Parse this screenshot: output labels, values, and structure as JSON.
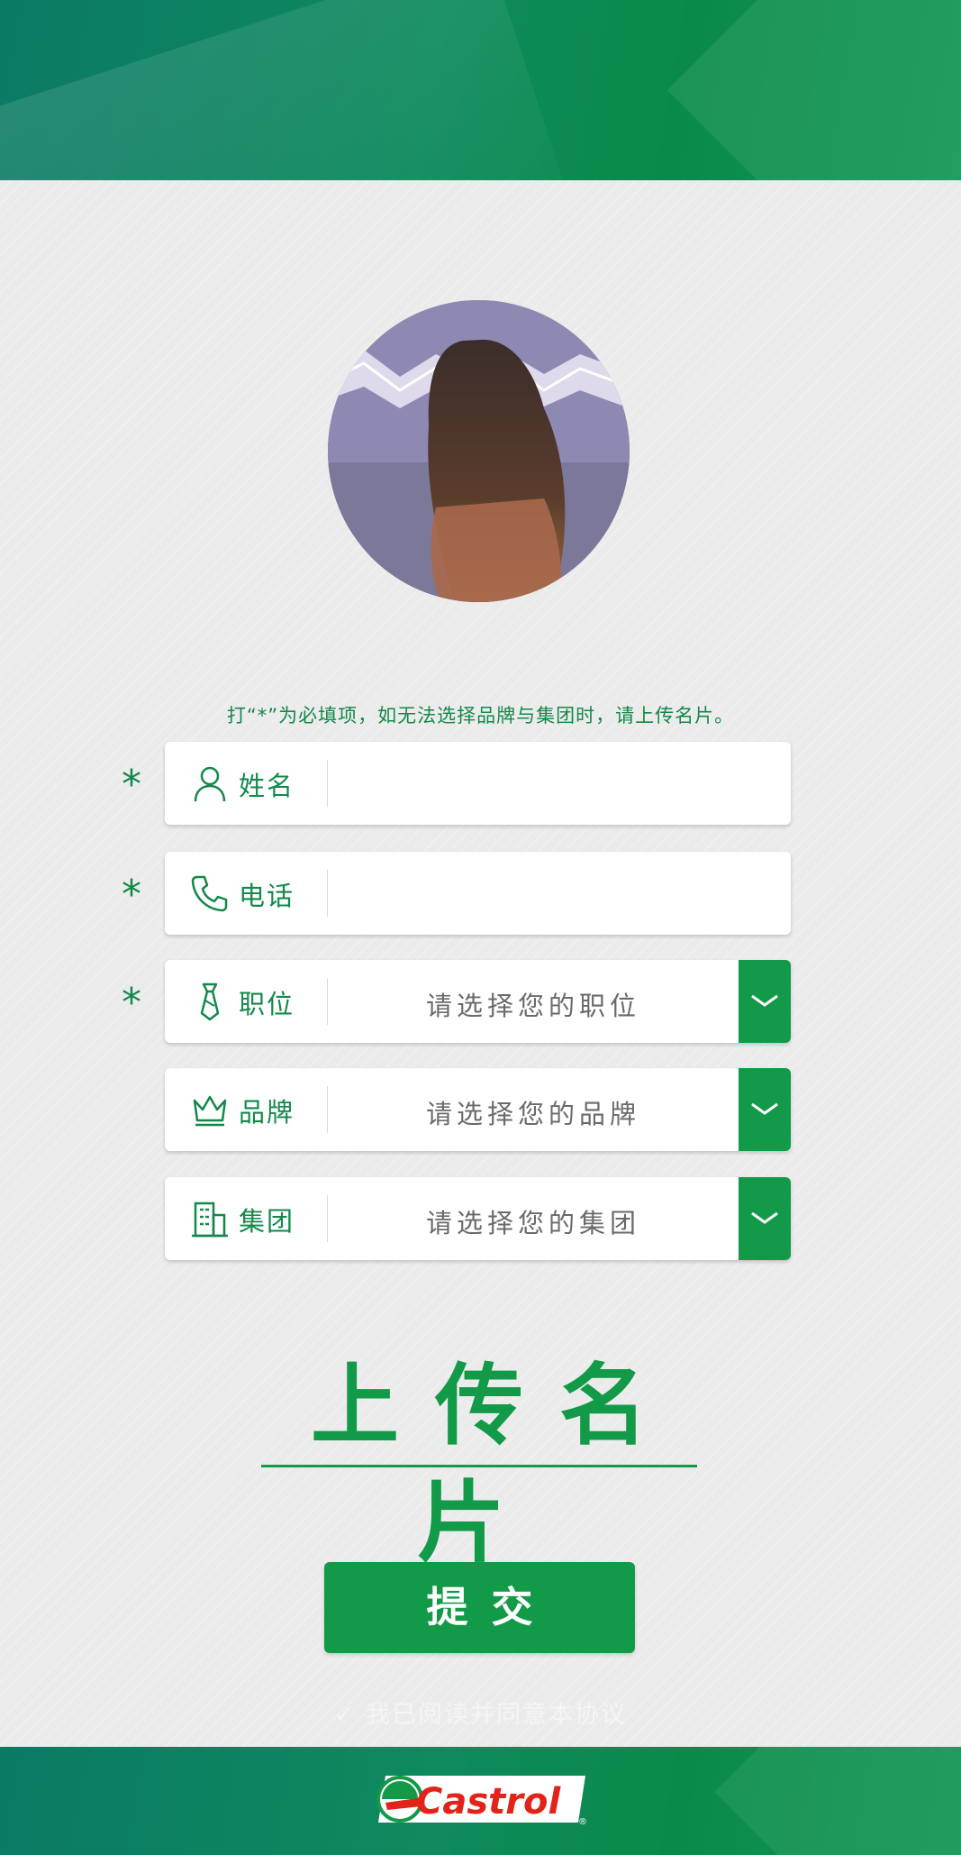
{
  "instructions": "打“*”为必填项，如无法选择品牌与集团时，请上传名片。",
  "fields": [
    {
      "required_mark": "*",
      "icon": "person-icon",
      "label": "姓名",
      "value": ""
    },
    {
      "required_mark": "*",
      "icon": "phone-icon",
      "label": "电话",
      "value": ""
    },
    {
      "required_mark": "*",
      "icon": "tie-icon",
      "label": "职位",
      "placeholder": "请选择您的职位"
    },
    {
      "required_mark": "",
      "icon": "crown-icon",
      "label": "品牌",
      "placeholder": "请选择您的品牌"
    },
    {
      "required_mark": "",
      "icon": "building-icon",
      "label": "集团",
      "placeholder": "请选择您的集团"
    }
  ],
  "upload_label": "上传名片",
  "submit_label": "提交",
  "agreement_text": "✓ 我已阅读并同意本协议",
  "brand": {
    "logo_text": "Castrol",
    "registered": "®"
  },
  "colors": {
    "accent": "#129a48",
    "banner": "#0b7a64",
    "logo_red": "#e2231a"
  }
}
